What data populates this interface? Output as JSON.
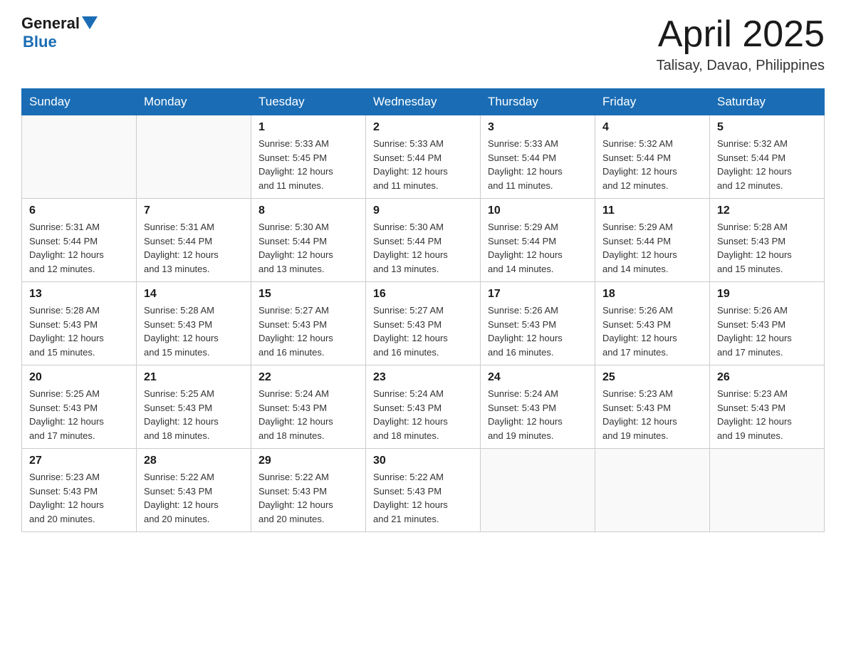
{
  "header": {
    "logo": {
      "general": "General",
      "blue": "Blue"
    },
    "title": "April 2025",
    "location": "Talisay, Davao, Philippines"
  },
  "weekdays": [
    "Sunday",
    "Monday",
    "Tuesday",
    "Wednesday",
    "Thursday",
    "Friday",
    "Saturday"
  ],
  "weeks": [
    [
      {
        "day": "",
        "info": ""
      },
      {
        "day": "",
        "info": ""
      },
      {
        "day": "1",
        "info": "Sunrise: 5:33 AM\nSunset: 5:45 PM\nDaylight: 12 hours\nand 11 minutes."
      },
      {
        "day": "2",
        "info": "Sunrise: 5:33 AM\nSunset: 5:44 PM\nDaylight: 12 hours\nand 11 minutes."
      },
      {
        "day": "3",
        "info": "Sunrise: 5:33 AM\nSunset: 5:44 PM\nDaylight: 12 hours\nand 11 minutes."
      },
      {
        "day": "4",
        "info": "Sunrise: 5:32 AM\nSunset: 5:44 PM\nDaylight: 12 hours\nand 12 minutes."
      },
      {
        "day": "5",
        "info": "Sunrise: 5:32 AM\nSunset: 5:44 PM\nDaylight: 12 hours\nand 12 minutes."
      }
    ],
    [
      {
        "day": "6",
        "info": "Sunrise: 5:31 AM\nSunset: 5:44 PM\nDaylight: 12 hours\nand 12 minutes."
      },
      {
        "day": "7",
        "info": "Sunrise: 5:31 AM\nSunset: 5:44 PM\nDaylight: 12 hours\nand 13 minutes."
      },
      {
        "day": "8",
        "info": "Sunrise: 5:30 AM\nSunset: 5:44 PM\nDaylight: 12 hours\nand 13 minutes."
      },
      {
        "day": "9",
        "info": "Sunrise: 5:30 AM\nSunset: 5:44 PM\nDaylight: 12 hours\nand 13 minutes."
      },
      {
        "day": "10",
        "info": "Sunrise: 5:29 AM\nSunset: 5:44 PM\nDaylight: 12 hours\nand 14 minutes."
      },
      {
        "day": "11",
        "info": "Sunrise: 5:29 AM\nSunset: 5:44 PM\nDaylight: 12 hours\nand 14 minutes."
      },
      {
        "day": "12",
        "info": "Sunrise: 5:28 AM\nSunset: 5:43 PM\nDaylight: 12 hours\nand 15 minutes."
      }
    ],
    [
      {
        "day": "13",
        "info": "Sunrise: 5:28 AM\nSunset: 5:43 PM\nDaylight: 12 hours\nand 15 minutes."
      },
      {
        "day": "14",
        "info": "Sunrise: 5:28 AM\nSunset: 5:43 PM\nDaylight: 12 hours\nand 15 minutes."
      },
      {
        "day": "15",
        "info": "Sunrise: 5:27 AM\nSunset: 5:43 PM\nDaylight: 12 hours\nand 16 minutes."
      },
      {
        "day": "16",
        "info": "Sunrise: 5:27 AM\nSunset: 5:43 PM\nDaylight: 12 hours\nand 16 minutes."
      },
      {
        "day": "17",
        "info": "Sunrise: 5:26 AM\nSunset: 5:43 PM\nDaylight: 12 hours\nand 16 minutes."
      },
      {
        "day": "18",
        "info": "Sunrise: 5:26 AM\nSunset: 5:43 PM\nDaylight: 12 hours\nand 17 minutes."
      },
      {
        "day": "19",
        "info": "Sunrise: 5:26 AM\nSunset: 5:43 PM\nDaylight: 12 hours\nand 17 minutes."
      }
    ],
    [
      {
        "day": "20",
        "info": "Sunrise: 5:25 AM\nSunset: 5:43 PM\nDaylight: 12 hours\nand 17 minutes."
      },
      {
        "day": "21",
        "info": "Sunrise: 5:25 AM\nSunset: 5:43 PM\nDaylight: 12 hours\nand 18 minutes."
      },
      {
        "day": "22",
        "info": "Sunrise: 5:24 AM\nSunset: 5:43 PM\nDaylight: 12 hours\nand 18 minutes."
      },
      {
        "day": "23",
        "info": "Sunrise: 5:24 AM\nSunset: 5:43 PM\nDaylight: 12 hours\nand 18 minutes."
      },
      {
        "day": "24",
        "info": "Sunrise: 5:24 AM\nSunset: 5:43 PM\nDaylight: 12 hours\nand 19 minutes."
      },
      {
        "day": "25",
        "info": "Sunrise: 5:23 AM\nSunset: 5:43 PM\nDaylight: 12 hours\nand 19 minutes."
      },
      {
        "day": "26",
        "info": "Sunrise: 5:23 AM\nSunset: 5:43 PM\nDaylight: 12 hours\nand 19 minutes."
      }
    ],
    [
      {
        "day": "27",
        "info": "Sunrise: 5:23 AM\nSunset: 5:43 PM\nDaylight: 12 hours\nand 20 minutes."
      },
      {
        "day": "28",
        "info": "Sunrise: 5:22 AM\nSunset: 5:43 PM\nDaylight: 12 hours\nand 20 minutes."
      },
      {
        "day": "29",
        "info": "Sunrise: 5:22 AM\nSunset: 5:43 PM\nDaylight: 12 hours\nand 20 minutes."
      },
      {
        "day": "30",
        "info": "Sunrise: 5:22 AM\nSunset: 5:43 PM\nDaylight: 12 hours\nand 21 minutes."
      },
      {
        "day": "",
        "info": ""
      },
      {
        "day": "",
        "info": ""
      },
      {
        "day": "",
        "info": ""
      }
    ]
  ]
}
